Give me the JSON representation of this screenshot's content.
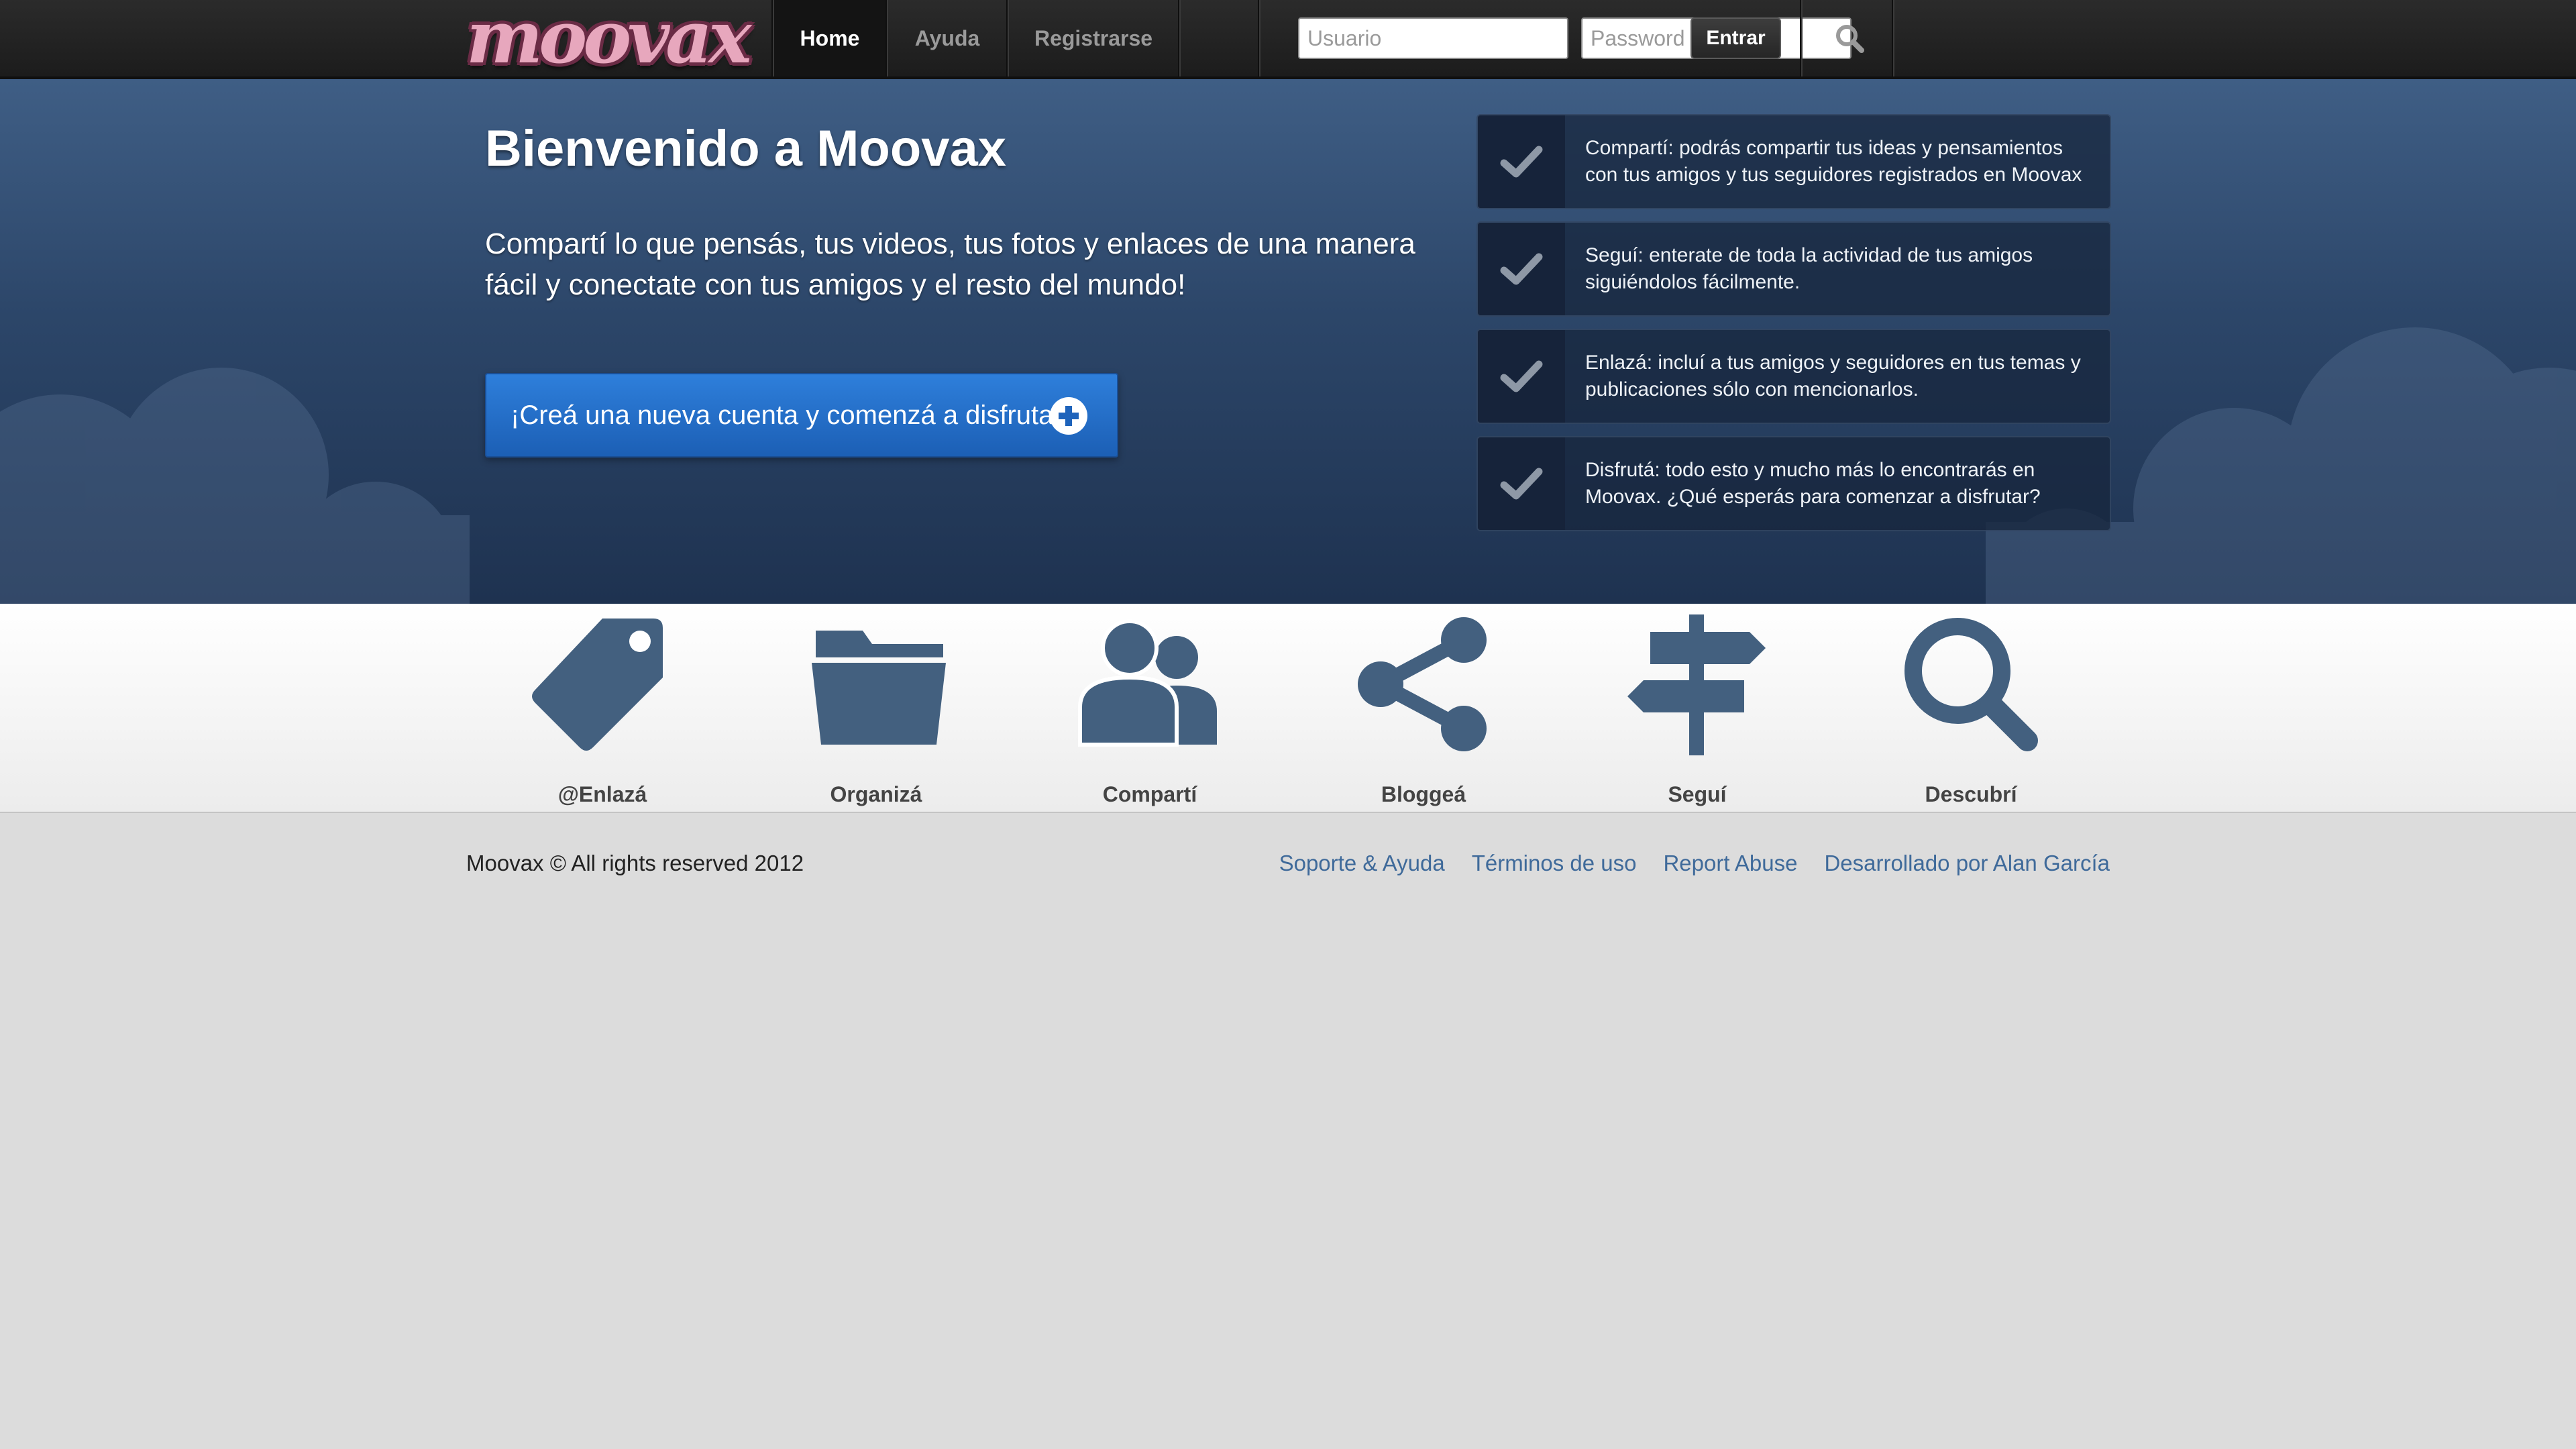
{
  "header": {
    "logo_text": "moovax",
    "nav": [
      {
        "label": "Home",
        "active": true
      },
      {
        "label": "Ayuda",
        "active": false
      },
      {
        "label": "Registrarse",
        "active": false
      }
    ],
    "login": {
      "username_placeholder": "Usuario",
      "password_placeholder": "Password",
      "submit_label": "Entrar",
      "search_icon": "search-icon"
    }
  },
  "hero": {
    "title": "Bienvenido a Moovax",
    "subtitle": "Compartí lo que pensás, tus videos, tus fotos y enlaces de una manera fácil y conectate con tus amigos y el resto del mundo!",
    "cta_label": "¡Creá una nueva cuenta y comenzá a disfrutar!",
    "cta_icon": "plus-circle-icon",
    "features": [
      {
        "text": "Compartí: podrás compartir tus ideas y pensamientos con tus amigos y tus seguidores registrados en Moovax",
        "icon": "check-icon"
      },
      {
        "text": "Seguí: enterate de toda la actividad de tus amigos siguiéndolos fácilmente.",
        "icon": "check-icon"
      },
      {
        "text": "Enlazá: incluí a tus amigos y seguidores en tus temas y publicaciones sólo con mencionarlos.",
        "icon": "check-icon"
      },
      {
        "text": "Disfrutá: todo esto y mucho más lo encontrarás en Moovax. ¿Qué esperás para comenzar a disfrutar?",
        "icon": "check-icon"
      }
    ]
  },
  "strip": {
    "items": [
      {
        "label": "@Enlazá",
        "icon": "tag-icon"
      },
      {
        "label": "Organizá",
        "icon": "folder-icon"
      },
      {
        "label": "Compartí",
        "icon": "users-icon"
      },
      {
        "label": "Bloggeá",
        "icon": "share-icon"
      },
      {
        "label": "Seguí",
        "icon": "signpost-icon"
      },
      {
        "label": "Descubrí",
        "icon": "search-icon"
      }
    ],
    "icon_color": "#43607f"
  },
  "footer": {
    "copyright": "Moovax © All rights reserved 2012",
    "links": [
      "Soporte & Ayuda",
      "Términos de uso",
      "Report Abuse",
      "Desarrollado por Alan García"
    ]
  },
  "colors": {
    "topbar": "#222222",
    "hero_top": "#3f5e85",
    "hero_bottom": "#1e3250",
    "cta": "#2675d0",
    "link": "#3f6a9a",
    "page_bg": "#dcdcdc"
  }
}
